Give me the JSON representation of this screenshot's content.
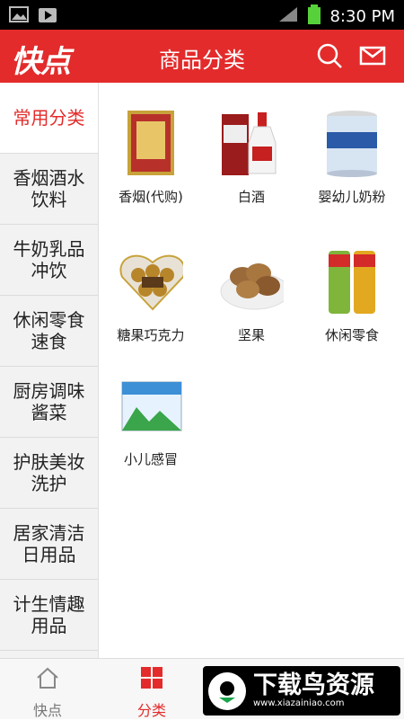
{
  "status": {
    "time": "8:30 PM"
  },
  "header": {
    "logo": "快点",
    "title": "商品分类"
  },
  "sidebar": {
    "items": [
      {
        "label": "常用分类"
      },
      {
        "label": "香烟酒水饮料"
      },
      {
        "label": "牛奶乳品冲饮"
      },
      {
        "label": "休闲零食速食"
      },
      {
        "label": "厨房调味酱菜"
      },
      {
        "label": "护肤美妆洗护"
      },
      {
        "label": "居家清洁日用品"
      },
      {
        "label": "计生情趣用品"
      }
    ]
  },
  "categories": [
    {
      "label": "香烟(代购)"
    },
    {
      "label": "白酒"
    },
    {
      "label": "婴幼儿奶粉"
    },
    {
      "label": "糖果巧克力"
    },
    {
      "label": "坚果"
    },
    {
      "label": "休闲零食"
    },
    {
      "label": "小儿感冒"
    }
  ],
  "bottom_nav": {
    "tabs": [
      {
        "label": "快点"
      },
      {
        "label": "分类"
      }
    ]
  },
  "watermark": {
    "title": "下载鸟资源",
    "url": "www.xiazainiao.com"
  },
  "colors": {
    "brand": "#e32b2b",
    "active_tab": "#e32b2b"
  }
}
